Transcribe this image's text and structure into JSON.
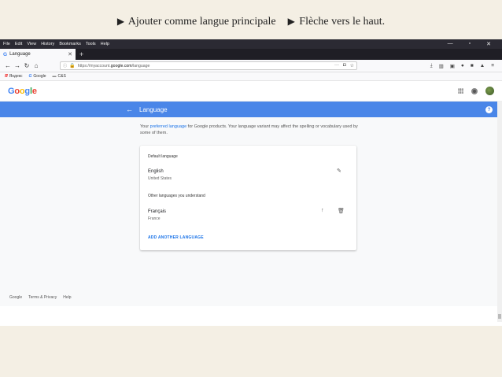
{
  "caption": {
    "item1": "Ajouter comme langue principale",
    "item2": "Flèche vers le haut."
  },
  "browser": {
    "menus": [
      "File",
      "Edit",
      "View",
      "History",
      "Bookmarks",
      "Tools",
      "Help"
    ],
    "window_controls": [
      "—",
      "▫",
      "✕"
    ],
    "tab_title": "Language",
    "tab_close": "✕",
    "new_tab": "+",
    "url_prefix": "https://myaccount.",
    "url_domain": "google.com",
    "url_path": "/language",
    "url_dots": "···",
    "bookmarks": [
      "Яндекс",
      "Google",
      "C&S"
    ]
  },
  "google": {
    "logo_letters": [
      "G",
      "o",
      "o",
      "g",
      "l",
      "e"
    ],
    "logo_colors": [
      "#4285F4",
      "#EA4335",
      "#FBBC05",
      "#4285F4",
      "#34A853",
      "#EA4335"
    ]
  },
  "bluebar": {
    "title": "Language",
    "help": "?",
    "color": "#4A86E8"
  },
  "intro": {
    "pre": "Your ",
    "link": "preferred language",
    "post": " for Google products. Your language variant may affect the spelling or vocabulary used by some of them."
  },
  "card": {
    "default_heading": "Default language",
    "default_lang": "English",
    "default_region": "United States",
    "other_heading": "Other languages you understand",
    "other_lang": "Français",
    "other_region": "France",
    "add_label": "ADD ANOTHER LANGUAGE"
  },
  "footer": [
    "Google",
    "Terms & Privacy",
    "Help"
  ]
}
